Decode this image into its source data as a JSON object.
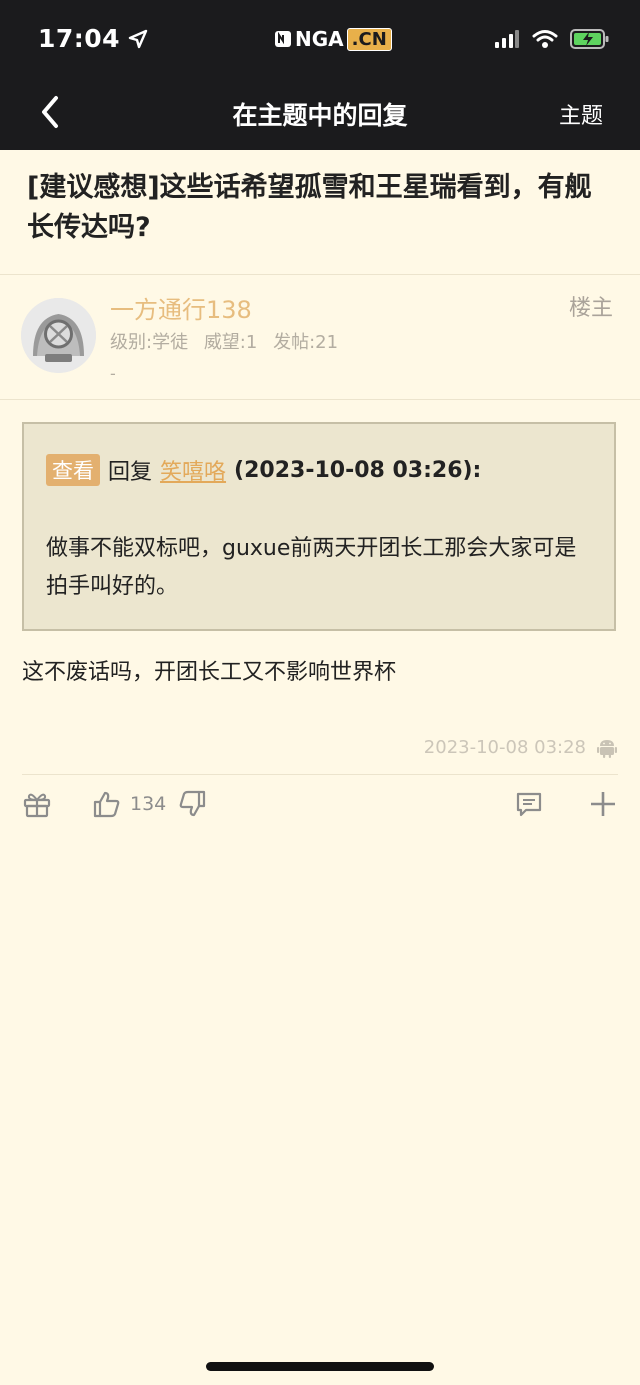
{
  "status_bar": {
    "time": "17:04",
    "logo_text": "NGA",
    "logo_badge": ".CN",
    "icons": [
      "location-arrow-icon",
      "signal-icon",
      "wifi-icon",
      "battery-charging-icon"
    ]
  },
  "nav": {
    "title": "在主题中的回复",
    "right_action": "主题"
  },
  "thread": {
    "title": "[建议感想]这些话希望孤雪和王星瑞看到，有舰长传达吗?"
  },
  "author": {
    "username": "一方通行138",
    "floor_tag": "楼主",
    "level": "级别:学徒",
    "prestige": "威望:1",
    "post_count": "发帖:21",
    "signature": "-"
  },
  "quote": {
    "view_badge": "查看",
    "reply_word": "回复",
    "quoted_user": "笑嘻咯",
    "quoted_time": "(2023-10-08 03:26):",
    "text": "做事不能双标吧，guxue前两天开团长工那会大家可是拍手叫好的。"
  },
  "post": {
    "body": "这不废话吗，开团长工又不影响世界杯",
    "timestamp": "2023-10-08 03:28",
    "device_icon": "android-icon"
  },
  "actions": {
    "like_count": "134",
    "icons": [
      "gift-icon",
      "thumbs-up-icon",
      "thumbs-down-icon",
      "comment-icon",
      "plus-icon"
    ]
  },
  "colors": {
    "background": "#fff9e6",
    "topbar": "#1b1b1d",
    "username": "#e7bd7f",
    "quote_bg": "#ece6cf",
    "badge": "#e3b06f"
  }
}
